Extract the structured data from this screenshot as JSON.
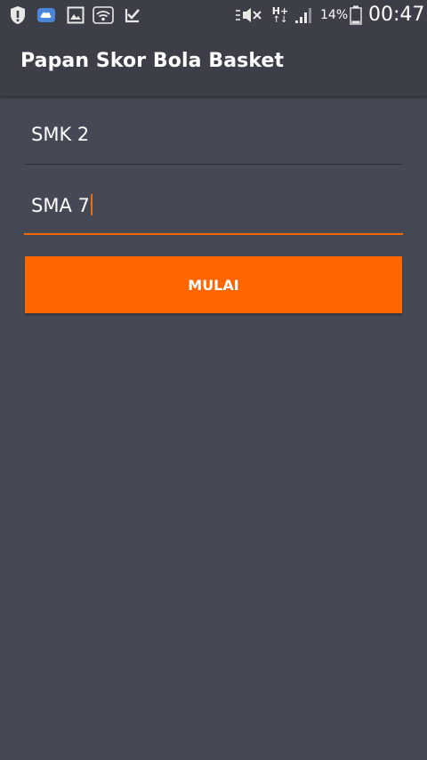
{
  "status_bar": {
    "battery_percent": "14%",
    "time": "00:47",
    "network_type": "H+",
    "icons": [
      "shield-alert-icon",
      "cloud-app-icon",
      "gallery-icon",
      "wifi-icon",
      "check-app-icon",
      "mute-icon",
      "network-icon",
      "signal-icon",
      "battery-icon"
    ]
  },
  "app_bar": {
    "title": "Papan Skor Bola Basket"
  },
  "form": {
    "team1_value": "SMK 2",
    "team2_value": "SMA 7",
    "start_label": "MULAI"
  },
  "colors": {
    "accent": "#ff6600",
    "background": "#454955",
    "app_bar": "#3c3f48"
  }
}
